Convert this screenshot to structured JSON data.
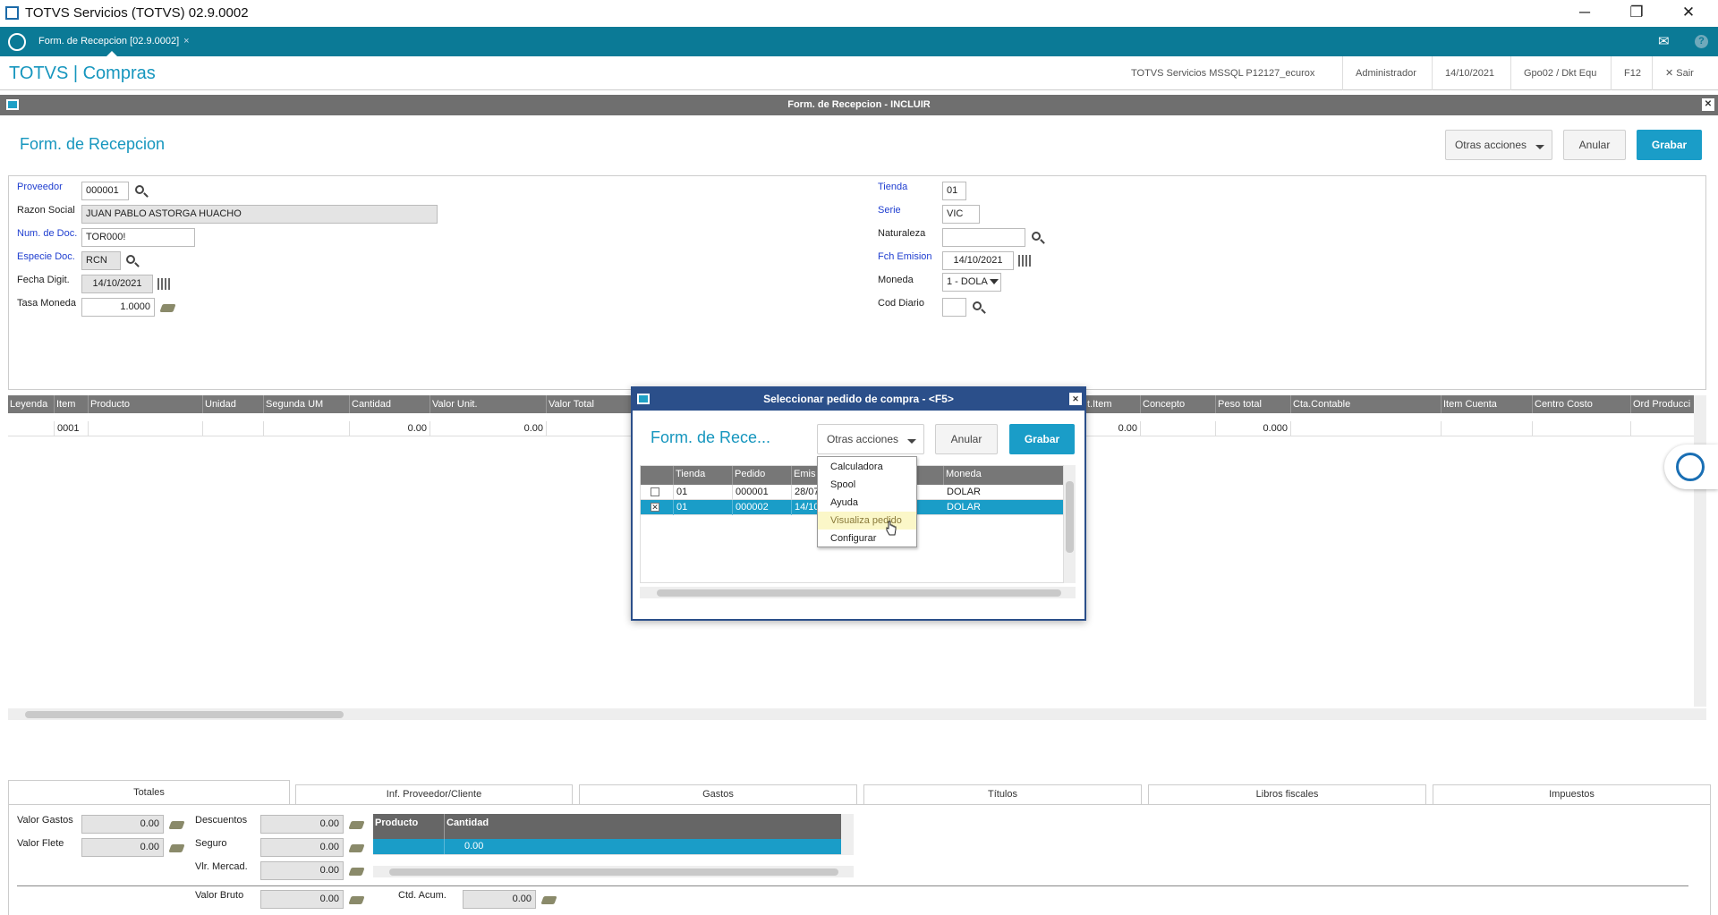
{
  "window": {
    "title": "TOTVS Servicios (TOTVS) 02.9.0002",
    "minimize": "─",
    "restore": "❐",
    "close": "✕"
  },
  "tabbar": {
    "tab_label": "Form. de Recepcion [02.9.0002]",
    "tab_close": "×",
    "mail_icon": "✉",
    "help_icon": "?"
  },
  "header": {
    "brand": "TOTVS | Compras",
    "items": [
      "TOTVS Servicios MSSQL P12127_ecurox",
      "Administrador",
      "14/10/2021",
      "Gpo02 / Dkt Equ",
      "F12"
    ],
    "exit_label": "✕  Sair"
  },
  "formbar": {
    "title": "Form. de Recepcion - INCLUIR",
    "close": "✕"
  },
  "page": {
    "title": "Form. de Recepcion",
    "actions": {
      "more": "Otras acciones",
      "cancel": "Anular",
      "save": "Grabar"
    }
  },
  "form": {
    "left": [
      {
        "label": "Proveedor",
        "value": "000001",
        "required": true
      },
      {
        "label": "Razon Social",
        "value": "JUAN PABLO ASTORGA HUACHO",
        "required": false
      },
      {
        "label": "Num. de Doc.",
        "value": "TOR000!",
        "required": true
      },
      {
        "label": "Especie Doc.",
        "value": "RCN",
        "required": true
      },
      {
        "label": "Fecha Digit.",
        "value": "14/10/2021",
        "required": false
      },
      {
        "label": "Tasa Moneda",
        "value": "1.0000",
        "required": false
      }
    ],
    "right": [
      {
        "label": "Tienda",
        "value": "01",
        "required": true
      },
      {
        "label": "Serie",
        "value": "VIC",
        "required": true
      },
      {
        "label": "Naturaleza",
        "value": "",
        "required": false
      },
      {
        "label": "Fch Emision",
        "value": "14/10/2021",
        "required": true
      },
      {
        "label": "Moneda",
        "value": "1 - DOLA",
        "required": false
      },
      {
        "label": "Cod Diario",
        "value": "",
        "required": false
      }
    ]
  },
  "grid": {
    "headers": [
      "Leyenda",
      "Item",
      "Producto",
      "Unidad",
      "Segunda UM",
      "Cantidad",
      "Valor Unit.",
      "Valor Total",
      "t.Item",
      "Concepto",
      "Peso total",
      "Cta.Contable",
      "Item Cuenta",
      "Centro Costo",
      "Ord Producci"
    ],
    "row": [
      "",
      "0001",
      "",
      "",
      "",
      "0.00",
      "0.00",
      "",
      "0.00",
      "",
      "0.000",
      "",
      "",
      "",
      ""
    ]
  },
  "bottom_tabs": [
    "Totales",
    "Inf. Proveedor/Cliente",
    "Gastos",
    "Títulos",
    "Libros fiscales",
    "Impuestos"
  ],
  "totals": {
    "valor_gastos_label": "Valor Gastos",
    "valor_gastos": "0.00",
    "valor_flete_label": "Valor Flete",
    "valor_flete": "0.00",
    "descuentos_label": "Descuentos",
    "descuentos": "0.00",
    "seguro_label": "Seguro",
    "seguro": "0.00",
    "vlr_mercad_label": "Vlr. Mercad.",
    "vlr_mercad": "0.00",
    "valor_bruto_label": "Valor Bruto",
    "valor_bruto": "0.00",
    "ctd_acum_label": "Ctd. Acum.",
    "ctd_acum": "0.00",
    "mini_grid_headers": [
      "Producto",
      "Cantidad"
    ],
    "mini_grid_row": [
      "",
      "0.00"
    ]
  },
  "dialog": {
    "title": "Seleccionar pedido de compra - <F5>",
    "close": "✕",
    "subtitle": "Form. de Rece...",
    "more": "Otras acciones",
    "cancel": "Anular",
    "save": "Grabar",
    "headers": [
      "",
      "Tienda",
      "Pedido",
      "Emis",
      "",
      "Moneda"
    ],
    "rows": [
      {
        "checked": "",
        "tienda": "01",
        "pedido": "000001",
        "emis": "28/07",
        "moneda": "DOLAR",
        "selected": false
      },
      {
        "checked": "✕",
        "tienda": "01",
        "pedido": "000002",
        "emis": "14/10",
        "moneda": "DOLAR",
        "selected": true
      }
    ],
    "menu": [
      "Calculadora",
      "Spool",
      "Ayuda",
      "Visualiza pedido",
      "Configurar"
    ],
    "menu_highlight": "Visualiza pedido"
  },
  "icons": {
    "search": "search-icon",
    "calendar": "calendar-icon",
    "money": "money-icon",
    "chat": "chat-assistant-icon"
  }
}
